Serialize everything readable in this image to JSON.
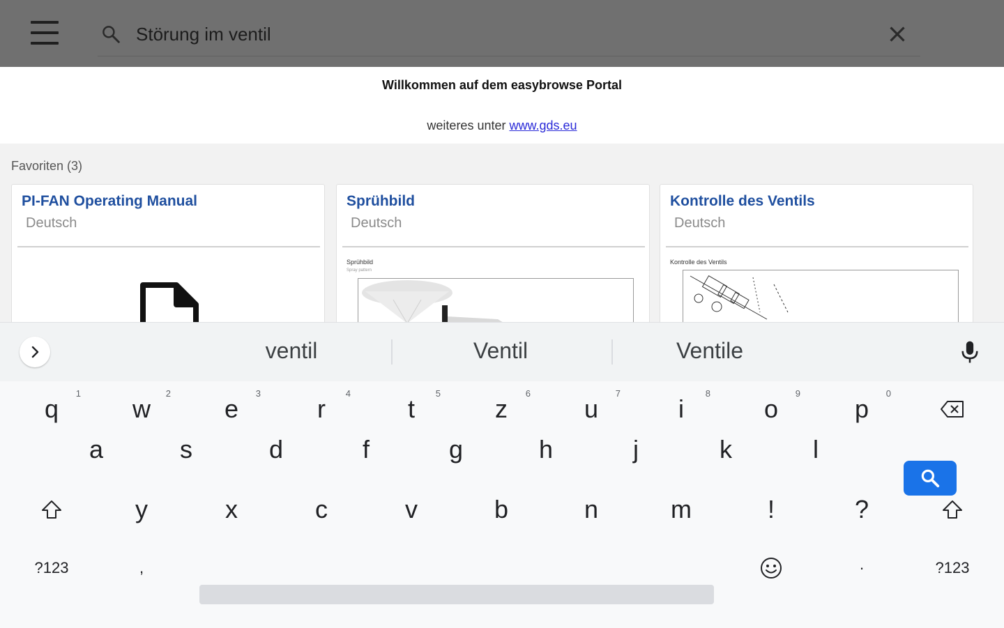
{
  "header": {
    "menu_icon": "hamburger-menu-icon",
    "search_icon": "search-icon",
    "search_value": "Störung im ventil",
    "clear_icon": "close-icon",
    "bar_color": "#707070"
  },
  "welcome": {
    "title": "Willkommen auf dem easybrowse Portal",
    "sub_prefix": "weiteres unter",
    "link": "www.gds.eu"
  },
  "favorites": {
    "label": "Favoriten (3)",
    "cards": [
      {
        "title": "PI-FAN Operating Manual",
        "lang": "Deutsch",
        "thumb": "document-icon"
      },
      {
        "title": "Sprühbild",
        "lang": "Deutsch",
        "thumb_caption": "Sprühbild",
        "thumb_sub": "Spray pattern"
      },
      {
        "title": "Kontrolle des Ventils",
        "lang": "Deutsch",
        "thumb_caption": "Kontrolle des Ventils"
      }
    ]
  },
  "keyboard": {
    "suggestions": [
      "ventil",
      "Ventil",
      "Ventile"
    ],
    "row1": [
      {
        "key": "q",
        "hint": "1"
      },
      {
        "key": "w",
        "hint": "2"
      },
      {
        "key": "e",
        "hint": "3"
      },
      {
        "key": "r",
        "hint": "4"
      },
      {
        "key": "t",
        "hint": "5"
      },
      {
        "key": "z",
        "hint": "6"
      },
      {
        "key": "u",
        "hint": "7"
      },
      {
        "key": "i",
        "hint": "8"
      },
      {
        "key": "o",
        "hint": "9"
      },
      {
        "key": "p",
        "hint": "0"
      }
    ],
    "row2": [
      "a",
      "s",
      "d",
      "f",
      "g",
      "h",
      "j",
      "k",
      "l"
    ],
    "row3": [
      "y",
      "x",
      "c",
      "v",
      "b",
      "n",
      "m",
      "!",
      "?"
    ],
    "symbols_label": "?123",
    "comma": ",",
    "period": "·",
    "accent_color": "#1a73e8"
  }
}
